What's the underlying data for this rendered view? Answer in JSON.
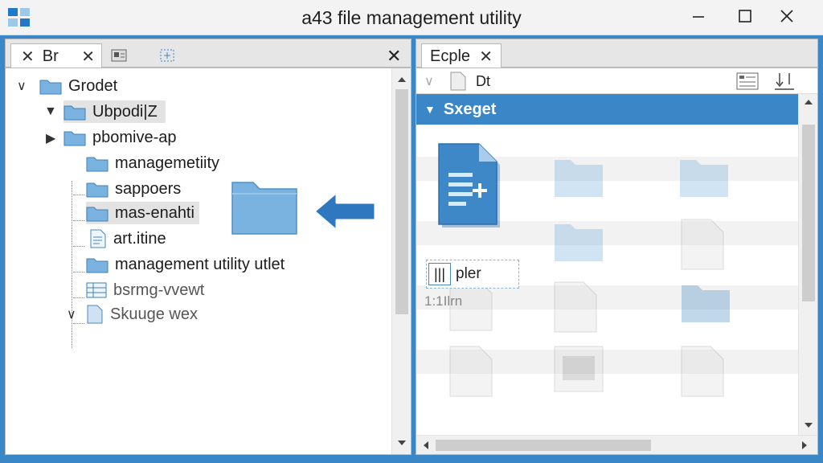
{
  "window": {
    "title": "a43 file management utility",
    "icons": {
      "app": "app-grid-icon",
      "minimize": "minimize-icon",
      "maximize": "maximize-icon",
      "close": "close-icon"
    }
  },
  "left_pane": {
    "tab_label": "Br",
    "tab_close": "✕",
    "pane_close": "✕",
    "tree": [
      {
        "label": "Grodet",
        "icon": "folder-icon",
        "state": "expanded"
      },
      {
        "label": "Ubpodi|Z",
        "icon": "folder-icon",
        "state": "expanded",
        "selected": true
      },
      {
        "label": "pbomive-ap",
        "icon": "folder-icon",
        "state": "collapsed"
      },
      {
        "label": "managemetiity",
        "icon": "folder-icon"
      },
      {
        "label": "sappoers",
        "icon": "folder-icon"
      },
      {
        "label": "mas-enahti",
        "icon": "folder-icon",
        "selected": true
      },
      {
        "label": "art.itine",
        "icon": "document-icon"
      },
      {
        "label": "management utility utlet",
        "icon": "folder-icon"
      },
      {
        "label": "bsrmg-vvewt",
        "icon": "table-icon",
        "faded": true
      },
      {
        "label": "Skuuge wex",
        "icon": "document-icon",
        "state": "expanded",
        "faded": true
      }
    ],
    "drag": {
      "ghost_icon": "folder-icon",
      "arrow_icon": "arrow-left-icon"
    }
  },
  "right_pane": {
    "tab_label": "Ecple",
    "tab_close": "✕",
    "toolbar_label": "Dt",
    "group_header": "Sxeget",
    "rename_value": "pler",
    "caption": "1:1Ilrn",
    "icons": {
      "details_view": "details-view-icon",
      "sort": "sort-icon"
    }
  },
  "colors": {
    "accent": "#3b86c6",
    "folder": "#7bb3e0"
  }
}
